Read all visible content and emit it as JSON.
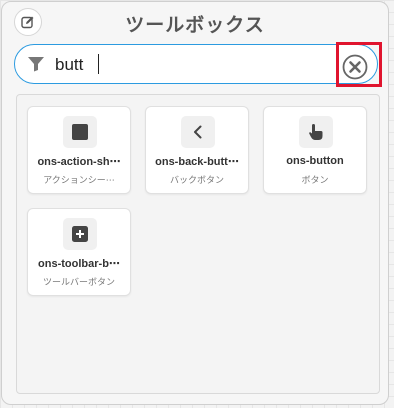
{
  "header": {
    "title": "ツールボックス",
    "edit_icon": "edit-icon"
  },
  "search": {
    "value": "butt",
    "filter_icon": "filter-icon",
    "clear_icon": "close-circle-icon"
  },
  "components": [
    {
      "name": "ons-action-sh⋯",
      "sub": "アクションシー⋯",
      "icon": "square-icon"
    },
    {
      "name": "ons-back-butt⋯",
      "sub": "バックボタン",
      "icon": "chevron-left-icon"
    },
    {
      "name": "ons-button",
      "sub": "ボタン",
      "icon": "pointer-hand-icon"
    },
    {
      "name": "ons-toolbar-b⋯",
      "sub": "ツールバーボタン",
      "icon": "plus-square-icon"
    }
  ],
  "colors": {
    "accent": "#2c9be0",
    "highlight": "#e0142e"
  }
}
